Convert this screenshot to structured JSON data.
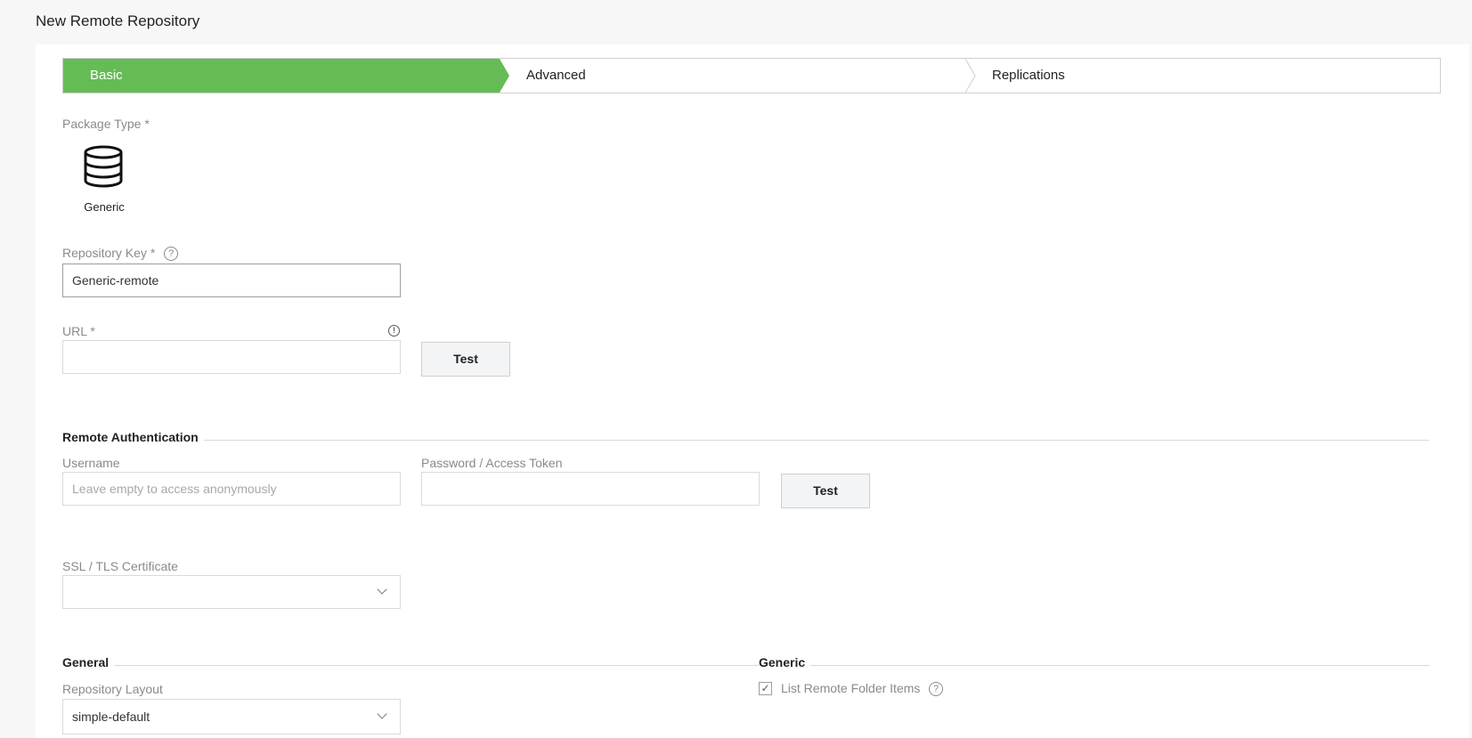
{
  "page": {
    "title": "New Remote Repository"
  },
  "wizard": {
    "steps": [
      {
        "label": "Basic",
        "active": true
      },
      {
        "label": "Advanced",
        "active": false
      },
      {
        "label": "Replications",
        "active": false
      }
    ],
    "active_color": "#65bc54"
  },
  "package_type": {
    "label": "Package Type *",
    "selected": {
      "name": "Generic",
      "icon": "database-icon"
    }
  },
  "repo_key": {
    "label": "Repository Key *",
    "value": "Generic-remote",
    "help_icon": "help-icon"
  },
  "url": {
    "label": "URL *",
    "value": "",
    "info_icon": "info-icon",
    "test_label": "Test"
  },
  "remote_auth": {
    "title": "Remote Authentication",
    "username_label": "Username",
    "username_placeholder": "Leave empty to access anonymously",
    "password_label": "Password / Access Token",
    "password_value": "",
    "test_label": "Test"
  },
  "ssl": {
    "label": "SSL / TLS Certificate",
    "value": ""
  },
  "general": {
    "title": "General",
    "layout_label": "Repository Layout",
    "layout_value": "simple-default"
  },
  "generic": {
    "title": "Generic",
    "list_remote_label": "List Remote Folder Items",
    "list_remote_checked": true
  }
}
